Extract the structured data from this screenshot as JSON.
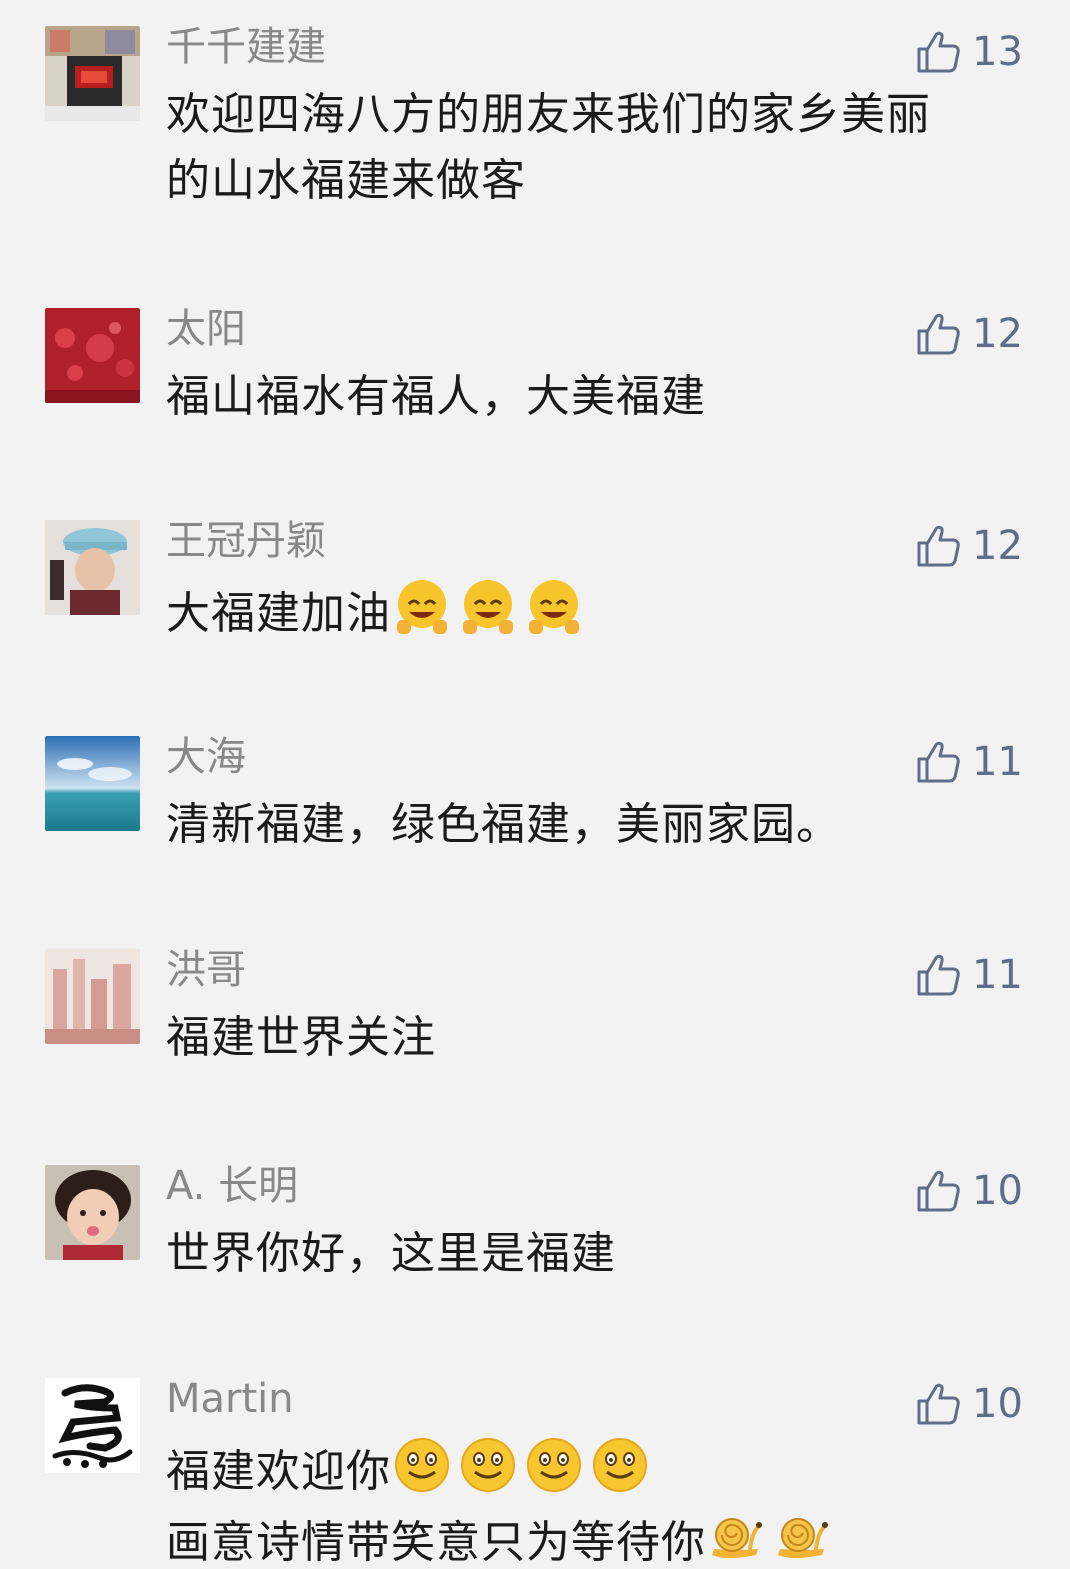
{
  "comments": [
    {
      "name": "千千建建",
      "likes": "13",
      "lines": [
        "欢迎四海八方的朋友来我们的家乡美丽",
        "的山水福建来做客"
      ],
      "avatar": "avatar-shop-photo"
    },
    {
      "name": "太阳",
      "likes": "12",
      "lines": [
        "福山福水有福人，大美福建"
      ],
      "avatar": "avatar-red-fu-pattern"
    },
    {
      "name": "王冠丹颖",
      "likes": "12",
      "lines": [
        "大福建加油"
      ],
      "trailing_emoji": [
        "peace-emoji",
        "peace-emoji",
        "peace-emoji"
      ],
      "avatar": "avatar-girl-with-cap"
    },
    {
      "name": "大海",
      "likes": "11",
      "lines": [
        "清新福建，绿色福建，美丽家园。"
      ],
      "avatar": "avatar-sea-sky"
    },
    {
      "name": "洪哥",
      "likes": "11",
      "lines": [
        "福建世界关注"
      ],
      "avatar": "avatar-city-model"
    },
    {
      "name": "A. 长明",
      "likes": "10",
      "lines": [
        "世界你好，这里是福建"
      ],
      "avatar": "avatar-child-face"
    },
    {
      "name": "Martin",
      "likes": "10",
      "lines": [
        "福建欢迎你",
        "画意诗情带笑意只为等待你"
      ],
      "line_emoji": [
        [
          "smile-emoji",
          "smile-emoji",
          "smile-emoji",
          "smile-emoji"
        ],
        [
          "snail-emoji",
          "snail-emoji"
        ]
      ],
      "avatar": "avatar-calligraphy-horse"
    }
  ],
  "colors": {
    "background": "#f2f2f2",
    "name_text": "#888888",
    "body_text": "#1b1b1b",
    "like_accent": "#5d6d8a"
  }
}
